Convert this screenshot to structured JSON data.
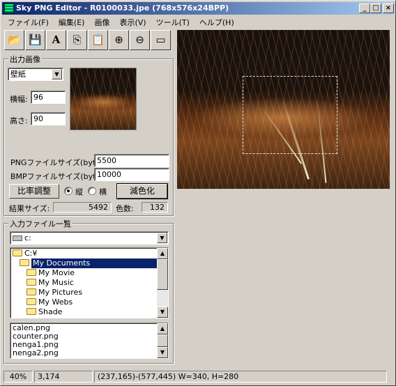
{
  "window": {
    "title": "Sky PNG Editor - R0100033.jpe (768x576x24BPP)",
    "controls": {
      "minimize": "_",
      "maximize": "□",
      "close": "×"
    }
  },
  "menu": [
    "ファイル(F)",
    "編集(E)",
    "画像",
    "表示(V)",
    "ツール(T)",
    "ヘルプ(H)"
  ],
  "toolbar": [
    {
      "name": "open-icon",
      "glyph": "📂"
    },
    {
      "name": "save-icon",
      "glyph": "💾"
    },
    {
      "name": "text-icon",
      "glyph": "A"
    },
    {
      "name": "copy-icon",
      "glyph": "⎘"
    },
    {
      "name": "paste-icon",
      "glyph": "📋"
    },
    {
      "name": "zoom-in-icon",
      "glyph": "⊕"
    },
    {
      "name": "zoom-out-icon",
      "glyph": "⊖"
    },
    {
      "name": "window-icon",
      "glyph": "▭"
    }
  ],
  "output": {
    "group_label": "出力画像",
    "mode_value": "壁紙",
    "width_label": "横幅:",
    "width_value": "96",
    "height_label": "高さ:",
    "height_value": "90",
    "png_size_label": "PNGファイルサイズ(byte):",
    "png_size_value": "5500",
    "bmp_size_label": "BMPファイルサイズ(byte):",
    "bmp_size_value": "10000",
    "ratio_button": "比率調整",
    "radio_vertical": "縦",
    "radio_horizontal": "横",
    "reduce_colors_button": "減色化",
    "result_size_label": "結果サイズ:",
    "result_size_value": "5492",
    "color_count_label": "色数:",
    "color_count_value": "132"
  },
  "input": {
    "group_label": "入力ファイル一覧",
    "drive_value": "c:",
    "folders": [
      {
        "label": "C:¥",
        "indent": 0,
        "selected": false
      },
      {
        "label": "My Documents",
        "indent": 1,
        "selected": true
      },
      {
        "label": "My Movie",
        "indent": 2,
        "selected": false
      },
      {
        "label": "My Music",
        "indent": 2,
        "selected": false
      },
      {
        "label": "My Pictures",
        "indent": 2,
        "selected": false
      },
      {
        "label": "My Webs",
        "indent": 2,
        "selected": false
      },
      {
        "label": "Shade",
        "indent": 2,
        "selected": false
      }
    ],
    "files": [
      "calen.png",
      "counter.png",
      "nenga1.png",
      "nenga2.png"
    ]
  },
  "status": {
    "zoom": "40%",
    "colors": "3,174",
    "selection": "(237,165)-(577,445) W=340, H=280"
  }
}
